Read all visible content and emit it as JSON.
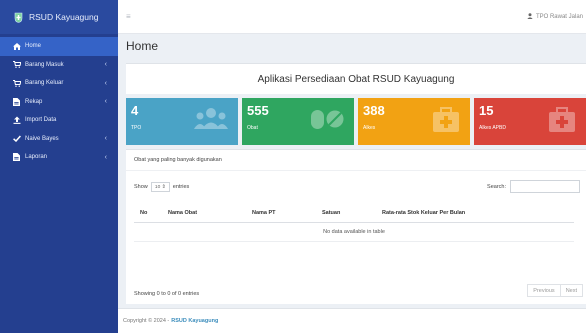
{
  "app": {
    "brand": "RSUD Kayuagung"
  },
  "sidebar": {
    "items": [
      {
        "label": "Home",
        "icon": "home-icon",
        "active": true,
        "has_children": false
      },
      {
        "label": "Barang Masuk",
        "icon": "cart-icon",
        "active": false,
        "has_children": true
      },
      {
        "label": "Barang Keluar",
        "icon": "cart-icon",
        "active": false,
        "has_children": true
      },
      {
        "label": "Rekap",
        "icon": "document-icon",
        "active": false,
        "has_children": true
      },
      {
        "label": "Import Data",
        "icon": "upload-icon",
        "active": false,
        "has_children": false
      },
      {
        "label": "Naive Bayes",
        "icon": "check-icon",
        "active": false,
        "has_children": true
      },
      {
        "label": "Laporan",
        "icon": "document-icon",
        "active": false,
        "has_children": true
      }
    ]
  },
  "topbar": {
    "menu_icon": "hamburger-icon",
    "user": "TPO Rawat Jalan"
  },
  "page": {
    "title": "Home",
    "banner": "Aplikasi Persediaan Obat RSUD Kayuagung"
  },
  "boxes": [
    {
      "value": "4",
      "label": "TPO",
      "color": "#4aa3c6",
      "icon": "users-icon"
    },
    {
      "value": "555",
      "label": "Obat",
      "color": "#2fa660",
      "icon": "pills-icon"
    },
    {
      "value": "388",
      "label": "Alkes",
      "color": "#f2a213",
      "icon": "medkit-icon"
    },
    {
      "value": "15",
      "label": "Alkes APBD",
      "color": "#d9443a",
      "icon": "medkit-icon"
    }
  ],
  "table": {
    "title": "Obat yang paling banyak digunakan",
    "show_label": "Show",
    "entries_value": "10",
    "entries_label": "entries",
    "search_label": "Search:",
    "columns": [
      "No",
      "Nama Obat",
      "Nama PT",
      "Satuan",
      "Rata-rata Stok Keluar Per Bulan"
    ],
    "empty_text": "No data available in table",
    "info": "Showing 0 to 0 of 0 entries",
    "previous": "Previous",
    "next": "Next"
  },
  "footer": {
    "text": "Copyright © 2024 -",
    "link": "RSUD Kayuagung"
  }
}
